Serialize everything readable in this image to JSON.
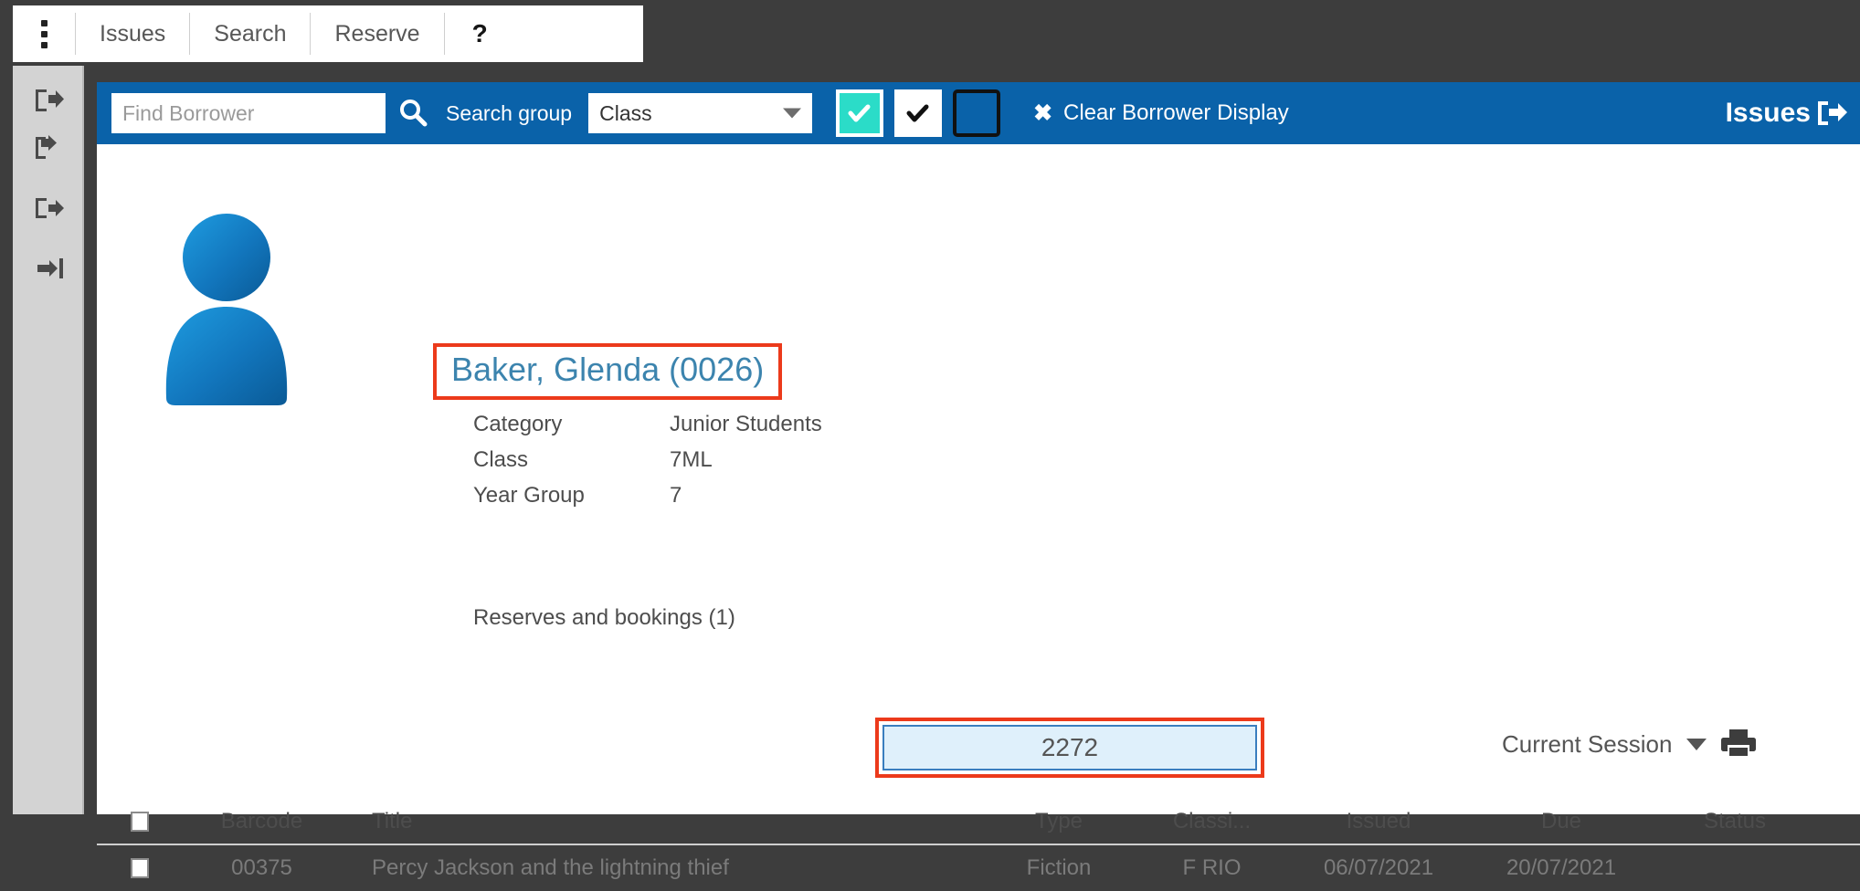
{
  "menu": {
    "kebab_icon": "kebab-menu-icon",
    "items": [
      {
        "label": "Issues"
      },
      {
        "label": "Search"
      },
      {
        "label": "Reserve"
      },
      {
        "label": "?"
      }
    ]
  },
  "sidebar": {
    "icons": [
      {
        "name": "check-out-icon"
      },
      {
        "name": "check-in-icon"
      },
      {
        "name": "exit-icon"
      },
      {
        "name": "enter-icon"
      }
    ]
  },
  "toolbar": {
    "find_borrower_placeholder": "Find Borrower",
    "find_borrower_value": "",
    "search_icon": "search-icon",
    "search_group_label": "Search group",
    "search_group_value": "Class",
    "search_group_options": [
      "Class"
    ],
    "checkbox_teal_icon": "check-mark-icon",
    "checkbox_white_icon": "check-mark-icon",
    "checkbox_empty_icon": "empty-checkbox-icon",
    "clear_x_glyph": "✖",
    "clear_label": "Clear Borrower Display",
    "issues_label": "Issues",
    "issues_icon": "exit-arrow-icon",
    "bar_color": "#0a62a9",
    "teal_color": "#2bdcc8"
  },
  "borrower": {
    "avatar_icon": "user-avatar-icon",
    "name": "Baker, Glenda (0026)",
    "name_color": "#3c84ae",
    "highlight_color": "#ec3a1b",
    "details": [
      {
        "label": "Category",
        "value": "Junior Students"
      },
      {
        "label": "Class",
        "value": "7ML"
      },
      {
        "label": "Year Group",
        "value": "7"
      }
    ],
    "reserves_label": "Reserves and bookings (1)"
  },
  "scan": {
    "barcode_value": "2272",
    "barcode_placeholder": "",
    "session_label": "Current Session",
    "session_options": [
      "Current Session"
    ],
    "print_icon": "printer-icon"
  },
  "table": {
    "headers": {
      "select": "",
      "barcode": "Barcode",
      "title": "Title",
      "type": "Type",
      "classification": "Classi...",
      "issued": "Issued",
      "due": "Due",
      "status": "Status"
    },
    "rows": [
      {
        "barcode": "00375",
        "title": "Percy Jackson and the lightning thief",
        "type": "Fiction",
        "classification": "F RIO",
        "issued": "06/07/2021",
        "due": "20/07/2021",
        "status": ""
      }
    ]
  }
}
